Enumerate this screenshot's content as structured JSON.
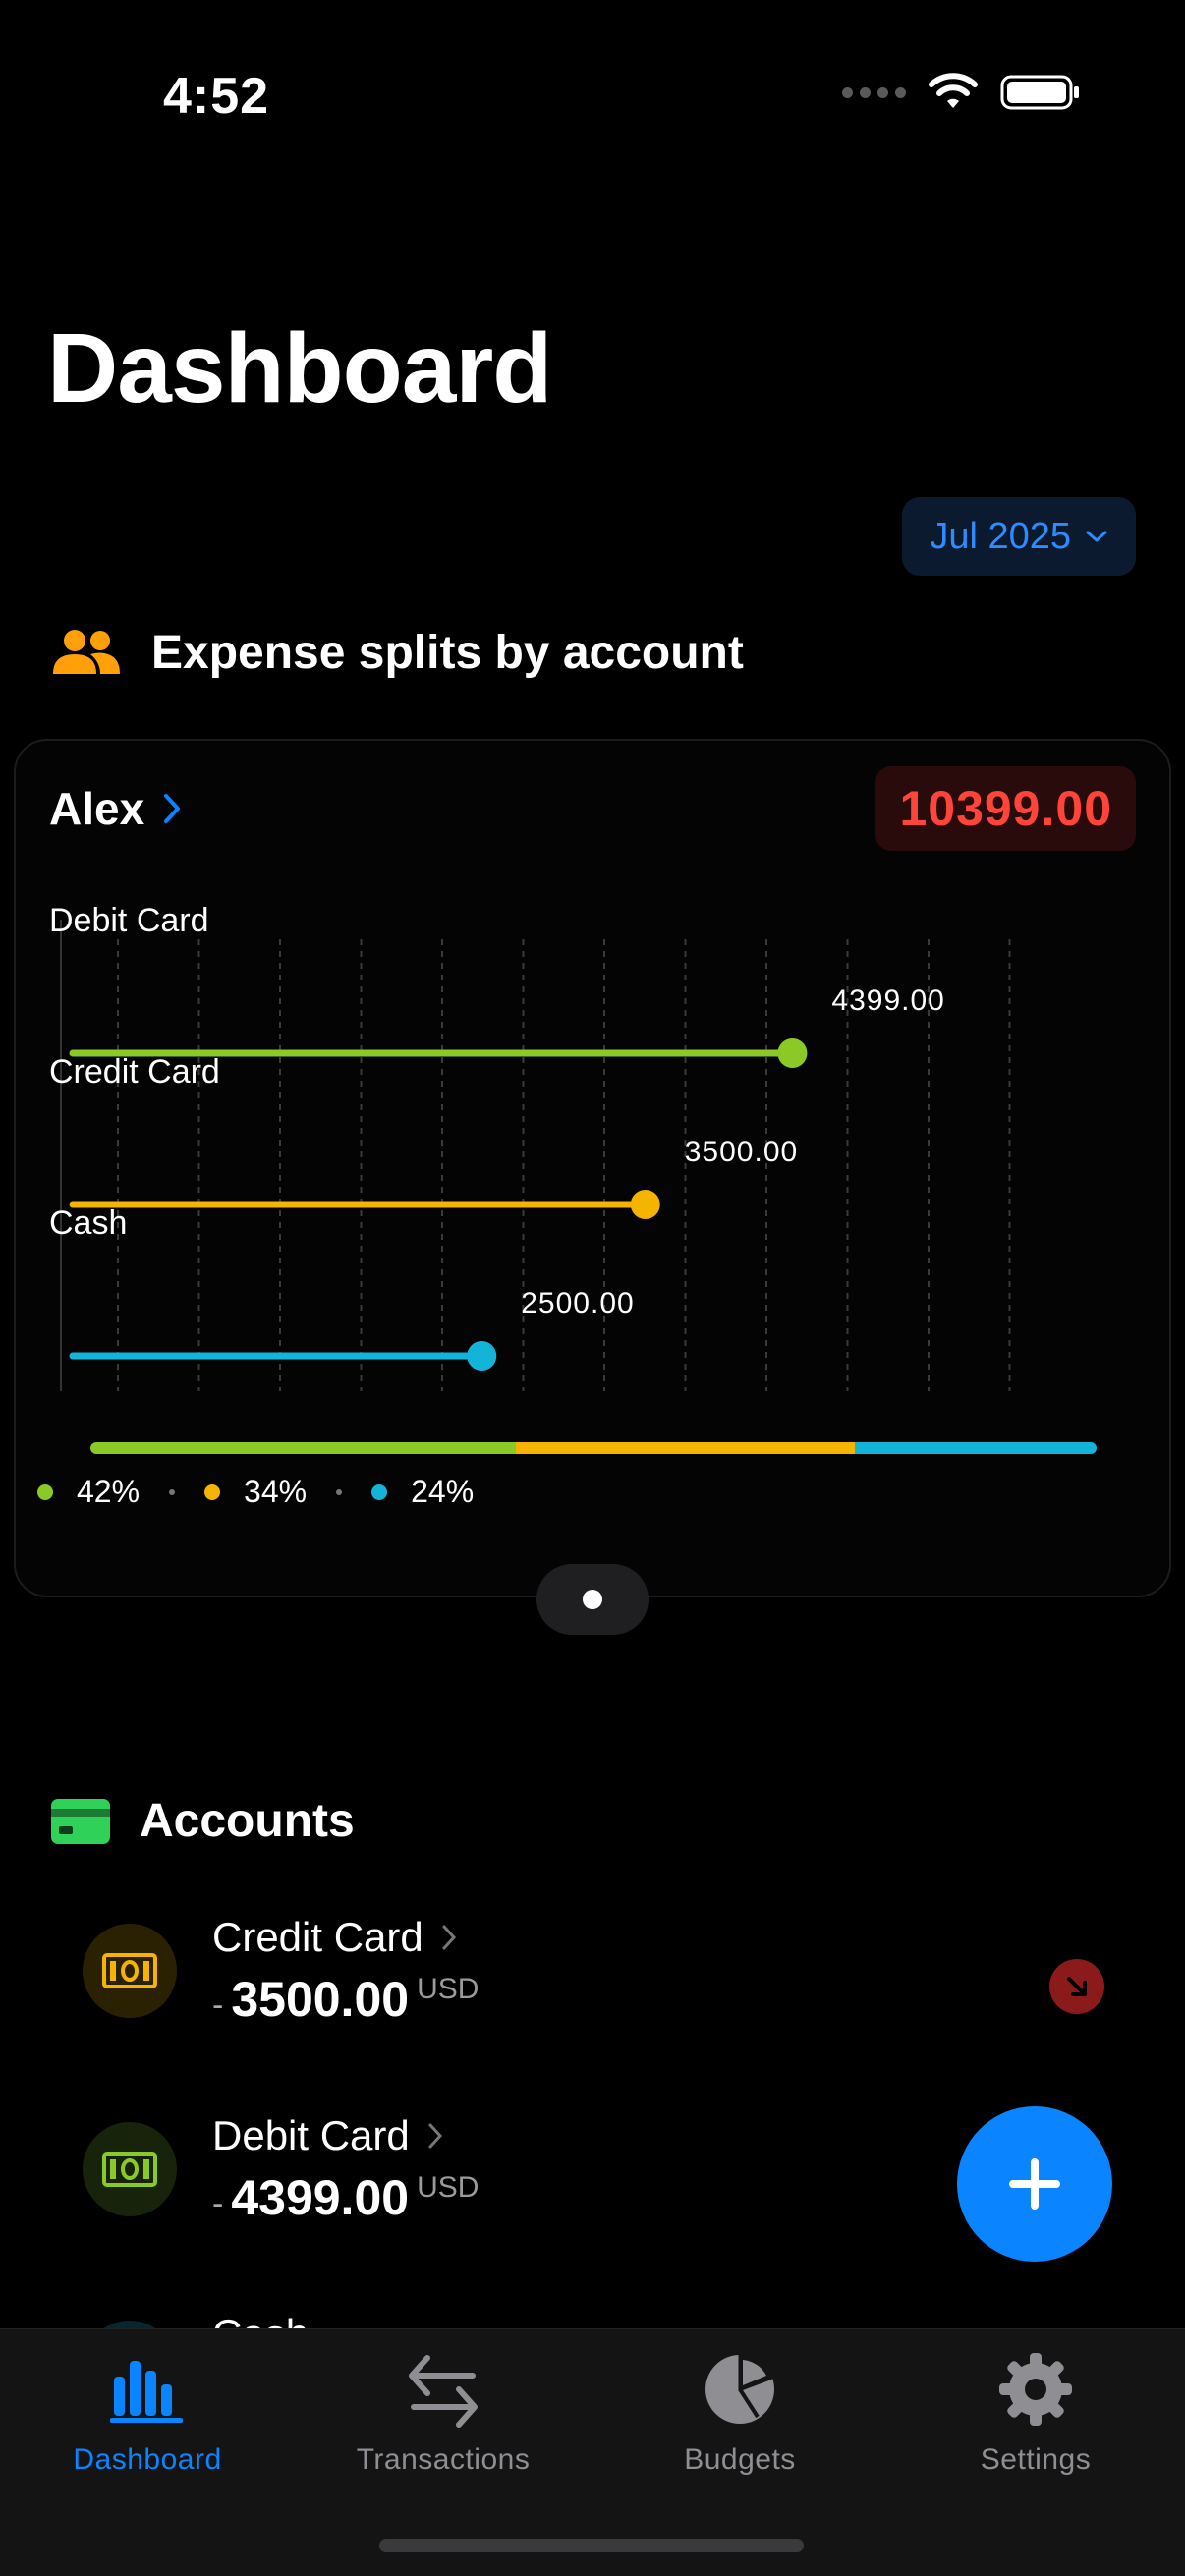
{
  "status_bar": {
    "time": "4:52"
  },
  "page": {
    "title": "Dashboard"
  },
  "month_selector": {
    "label": "Jul 2025"
  },
  "splits_section": {
    "title": "Expense splits by account",
    "card": {
      "owner": "Alex",
      "total": "10399.00",
      "bars": [
        {
          "label": "Debit Card",
          "value": 4399.0,
          "value_text": "4399.00",
          "color": "#8ac926"
        },
        {
          "label": "Credit Card",
          "value": 3500.0,
          "value_text": "3500.00",
          "color": "#f4b400"
        },
        {
          "label": "Cash",
          "value": 2500.0,
          "value_text": "2500.00",
          "color": "#12b5d8"
        }
      ],
      "legend": [
        {
          "percent": "42%",
          "color": "#8ac926"
        },
        {
          "percent": "34%",
          "color": "#f4b400"
        },
        {
          "percent": "24%",
          "color": "#12b5d8"
        }
      ]
    }
  },
  "accounts_section": {
    "title": "Accounts",
    "items": [
      {
        "name": "Credit Card",
        "sign": "-",
        "amount": "3500.00",
        "currency": "USD",
        "color": "#f4b400",
        "bg": "#2a2102"
      },
      {
        "name": "Debit Card",
        "sign": "-",
        "amount": "4399.00",
        "currency": "USD",
        "color": "#8ac926",
        "bg": "#17230a"
      },
      {
        "name": "Cash",
        "sign": "",
        "amount": "",
        "currency": "",
        "color": "#12b5d8",
        "bg": "#082530"
      }
    ]
  },
  "tab_bar": {
    "tabs": [
      {
        "label": "Dashboard",
        "icon": "bar-chart-icon",
        "active": true
      },
      {
        "label": "Transactions",
        "icon": "transfer-arrows-icon",
        "active": false
      },
      {
        "label": "Budgets",
        "icon": "pie-chart-icon",
        "active": false
      },
      {
        "label": "Settings",
        "icon": "gear-icon",
        "active": false
      }
    ]
  },
  "colors": {
    "accent": "#0a84ff",
    "negative": "#ff453a"
  }
}
